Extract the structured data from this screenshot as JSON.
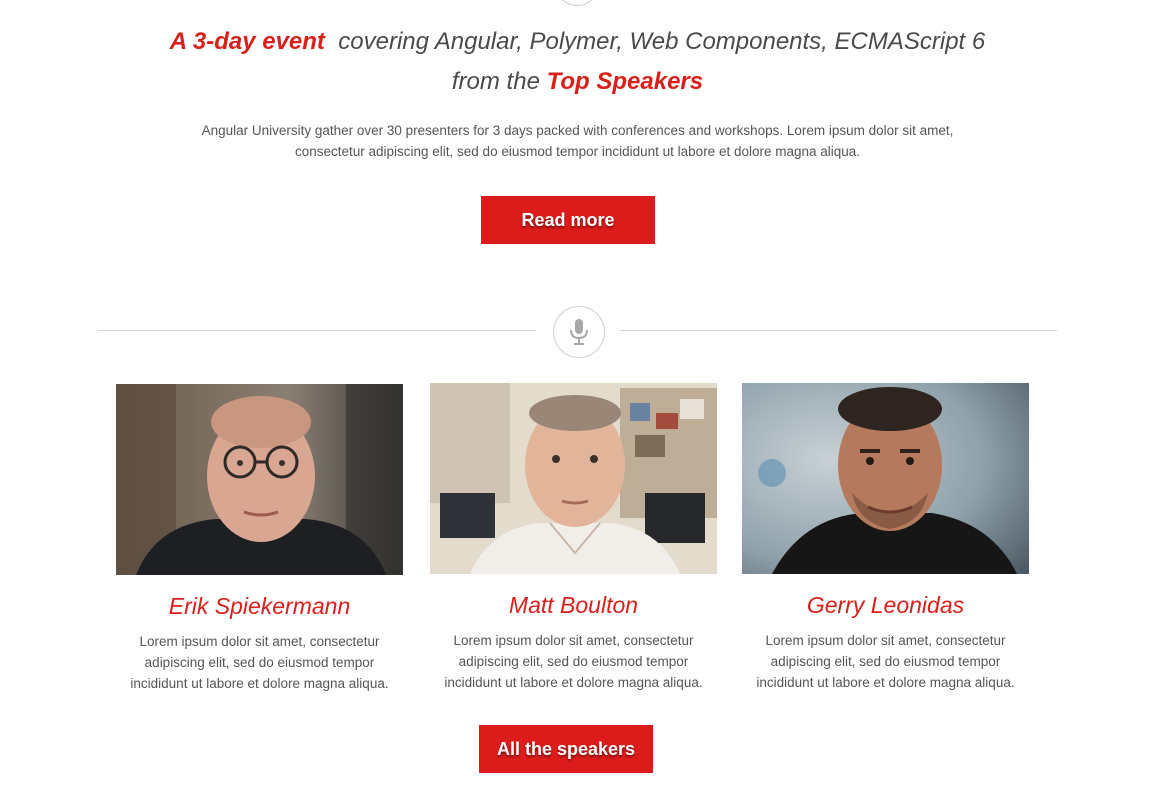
{
  "hero": {
    "headline_accent": "A 3-day event",
    "headline_middle": "covering Angular, Polymer, Web Components, ECMAScript 6",
    "headline_from": "from the",
    "headline_accent2": "Top Speakers",
    "intro": "Angular University gather over 30 presenters for 3 days packed with conferences and workshops. Lorem ipsum dolor sit amet, consectetur adipiscing elit, sed do eiusmod tempor incididunt ut labore et dolore magna aliqua.",
    "read_more_label": "Read more"
  },
  "divider": {
    "icon": "microphone-icon"
  },
  "speakers": [
    {
      "name": "Erik Spiekermann",
      "bio": "Lorem ipsum dolor sit amet, consectetur adipiscing elit, sed do eiusmod tempor incididunt ut labore et dolore magna aliqua."
    },
    {
      "name": "Matt Boulton",
      "bio": "Lorem ipsum dolor sit amet, consectetur adipiscing elit, sed do eiusmod tempor incididunt ut labore et dolore magna aliqua."
    },
    {
      "name": "Gerry Leonidas",
      "bio": "Lorem ipsum dolor sit amet, consectetur adipiscing elit, sed do eiusmod tempor incididunt ut labore et dolore magna aliqua."
    }
  ],
  "all_speakers_label": "All the speakers",
  "colors": {
    "accent": "#d9201b",
    "button": "#dc1c1a",
    "text": "#555555",
    "divider": "#d4d4d4"
  }
}
